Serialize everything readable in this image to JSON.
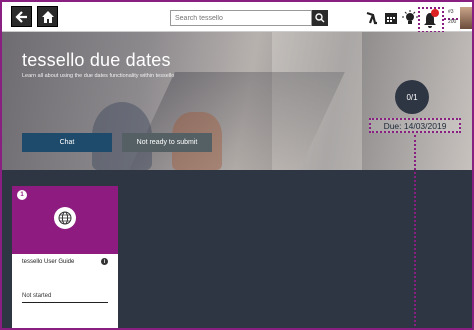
{
  "topbar": {
    "search_placeholder": "Search tessello",
    "icons": [
      "back-arrow-icon",
      "home-icon",
      "search-icon",
      "walk-icon",
      "calendar-icon",
      "lightbulb-icon",
      "bell-icon"
    ],
    "user_count": "#3",
    "user_sub": "200"
  },
  "hero": {
    "title": "tessello due dates",
    "subtitle": "Learn all about using the due dates functionality within tessello",
    "chat_label": "Chat",
    "submit_label": "Not ready to submit",
    "progress": "0/1",
    "due_date": "Due: 14/03/2019"
  },
  "card": {
    "number": "1",
    "title": "tessello User Guide",
    "status": "Not started",
    "icon": "globe-icon"
  },
  "colors": {
    "accent_purple": "#8e1b80",
    "dark_bg": "#2e3543",
    "chat_button": "#1e4a6b"
  }
}
